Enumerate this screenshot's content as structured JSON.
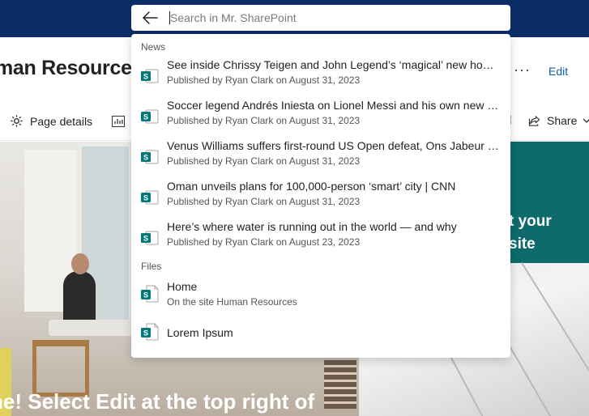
{
  "site": {
    "title": "man Resources",
    "more_label": "···",
    "edit_label": "Edit"
  },
  "commandbar": {
    "page_details_label": "Page details",
    "share_label": "Share"
  },
  "hero": {
    "caption": "ne! Select Edit at the top right of",
    "teal_line1": "t your",
    "teal_line2": "site"
  },
  "search": {
    "placeholder": "Search in Mr. SharePoint",
    "value": ""
  },
  "results": {
    "news_label": "News",
    "news": [
      {
        "title": "See inside Chrissy Teigen and John Legend’s ‘magical’ new home…",
        "meta": "Published by Ryan Clark on August 31, 2023"
      },
      {
        "title": "Soccer legend Andrés Iniesta on Lionel Messi and his own new a…",
        "meta": "Published by Ryan Clark on August 31, 2023"
      },
      {
        "title": "Venus Williams suffers first-round US Open defeat, Ons Jabeur b…",
        "meta": "Published by Ryan Clark on August 31, 2023"
      },
      {
        "title": "Oman unveils plans for 100,000-person ‘smart’ city | CNN",
        "meta": "Published by Ryan Clark on August 31, 2023"
      },
      {
        "title": "Here’s where water is running out in the world — and why",
        "meta": "Published by Ryan Clark on August 23, 2023"
      }
    ],
    "files_label": "Files",
    "files": [
      {
        "title": "Home",
        "meta": "On the site Human Resources"
      },
      {
        "title": "Lorem Ipsum"
      }
    ]
  },
  "colors": {
    "topbar": "#0b2d66",
    "sharepoint_green": "#03787c",
    "teal_panel": "#0f6b6b",
    "link_blue": "#0b5ea8"
  },
  "icons": {
    "back": "arrow-left-icon",
    "page": "sharepoint-page-icon",
    "settings": "gear-icon",
    "share": "share-icon"
  }
}
